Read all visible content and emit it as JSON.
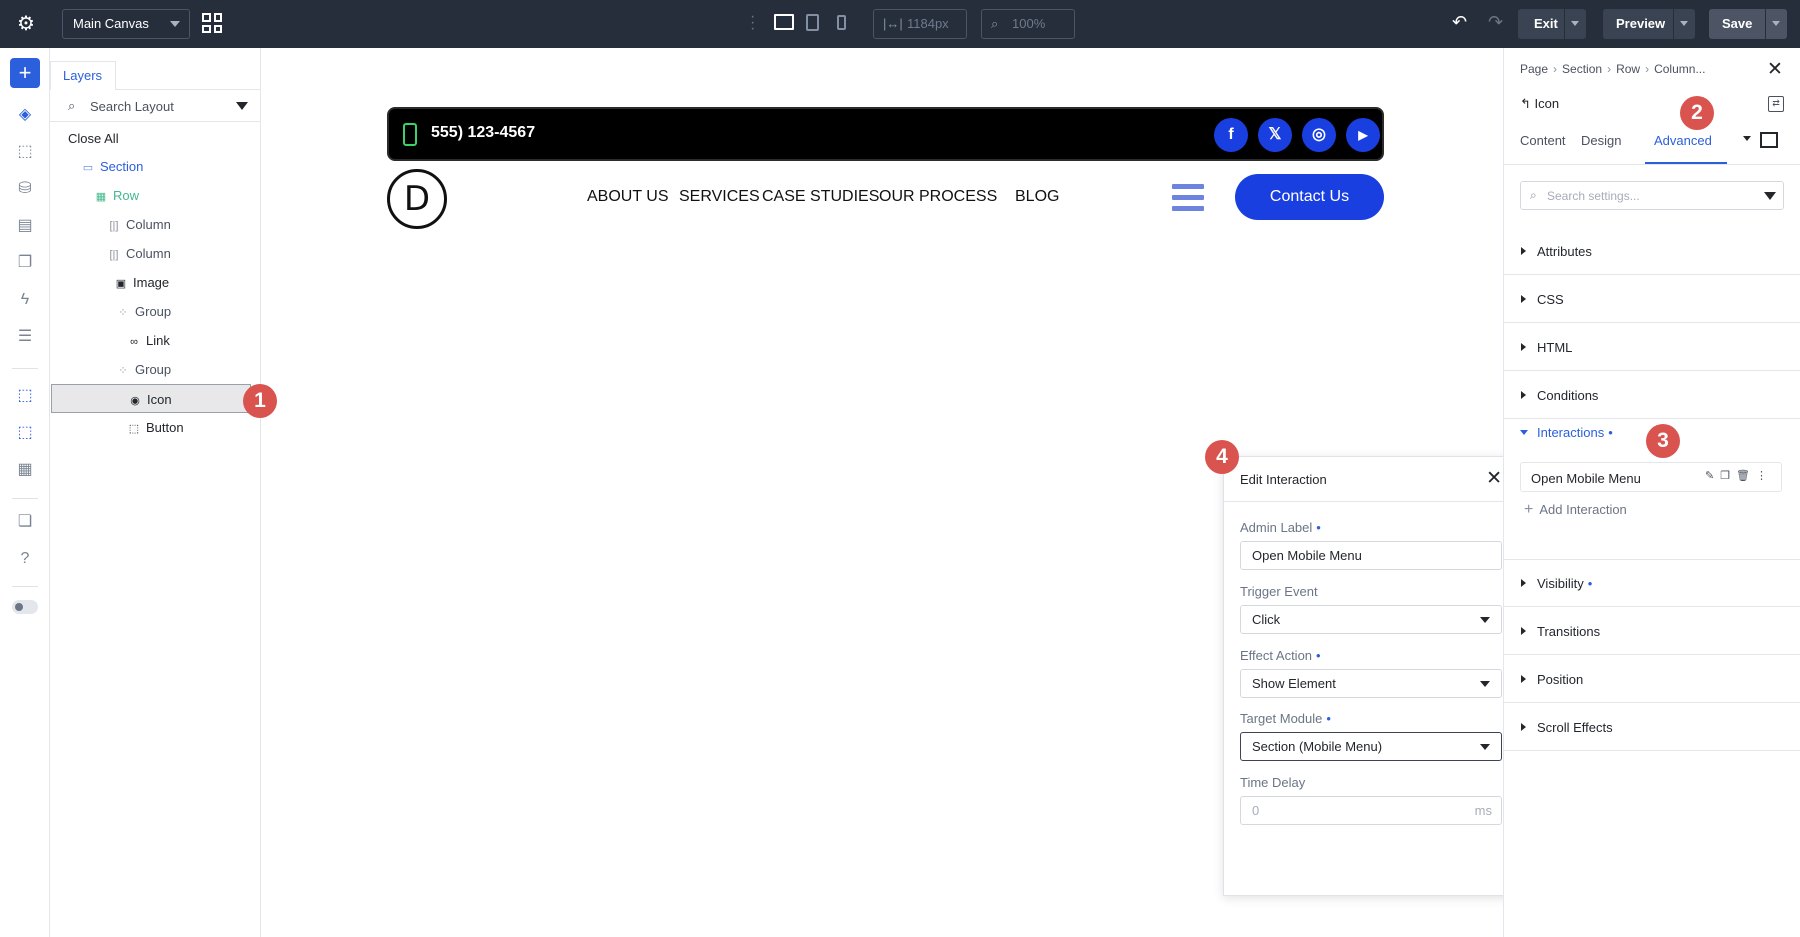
{
  "topbar": {
    "canvas_select": "Main Canvas",
    "width_value": "1184px",
    "zoom_value": "100%",
    "exit_label": "Exit",
    "preview_label": "Preview",
    "save_label": "Save"
  },
  "layers": {
    "tab_label": "Layers",
    "search_placeholder": "Search Layout",
    "items": [
      {
        "label": "Close All"
      },
      {
        "label": "Section"
      },
      {
        "label": "Row"
      },
      {
        "label": "Column"
      },
      {
        "label": "Column"
      },
      {
        "label": "Image"
      },
      {
        "label": "Group"
      },
      {
        "label": "Link"
      },
      {
        "label": "Group"
      },
      {
        "label": "Icon"
      },
      {
        "label": "Button"
      }
    ]
  },
  "callouts": [
    "1",
    "2",
    "3",
    "4"
  ],
  "site": {
    "phone": "555) 123-4567",
    "logo_letter": "D",
    "nav": [
      "ABOUT US",
      "SERVICES",
      "CASE STUDIES",
      "OUR PROCESS",
      "BLOG"
    ],
    "social_icons": [
      "facebook-icon",
      "x-icon",
      "instagram-icon",
      "youtube-icon"
    ],
    "contact_button": "Contact Us",
    "accent_color": "#1a3fe0"
  },
  "modal": {
    "title": "Edit Interaction",
    "admin_label": "Admin Label",
    "admin_value": "Open Mobile Menu",
    "trigger_label": "Trigger Event",
    "trigger_value": "Click",
    "effect_label": "Effect Action",
    "effect_value": "Show Element",
    "target_label": "Target Module",
    "target_value": "Section (Mobile Menu)",
    "delay_label": "Time Delay",
    "delay_placeholder": "0",
    "delay_unit": "ms"
  },
  "settings": {
    "breadcrumb": [
      "Page",
      "Section",
      "Row",
      "Column",
      "..."
    ],
    "module_name": "Icon",
    "tabs": [
      "Content",
      "Design",
      "Advanced"
    ],
    "active_tab": "Advanced",
    "search_placeholder": "Search settings...",
    "sections": [
      "Attributes",
      "CSS",
      "HTML",
      "Conditions",
      "Interactions",
      "Visibility",
      "Transitions",
      "Position",
      "Scroll Effects"
    ],
    "interaction_item": "Open Mobile Menu",
    "add_interaction": "Add Interaction"
  },
  "colors": {
    "topbar_bg": "#262e3b",
    "primary": "#2b5fdc",
    "callout": "#d9534f"
  }
}
